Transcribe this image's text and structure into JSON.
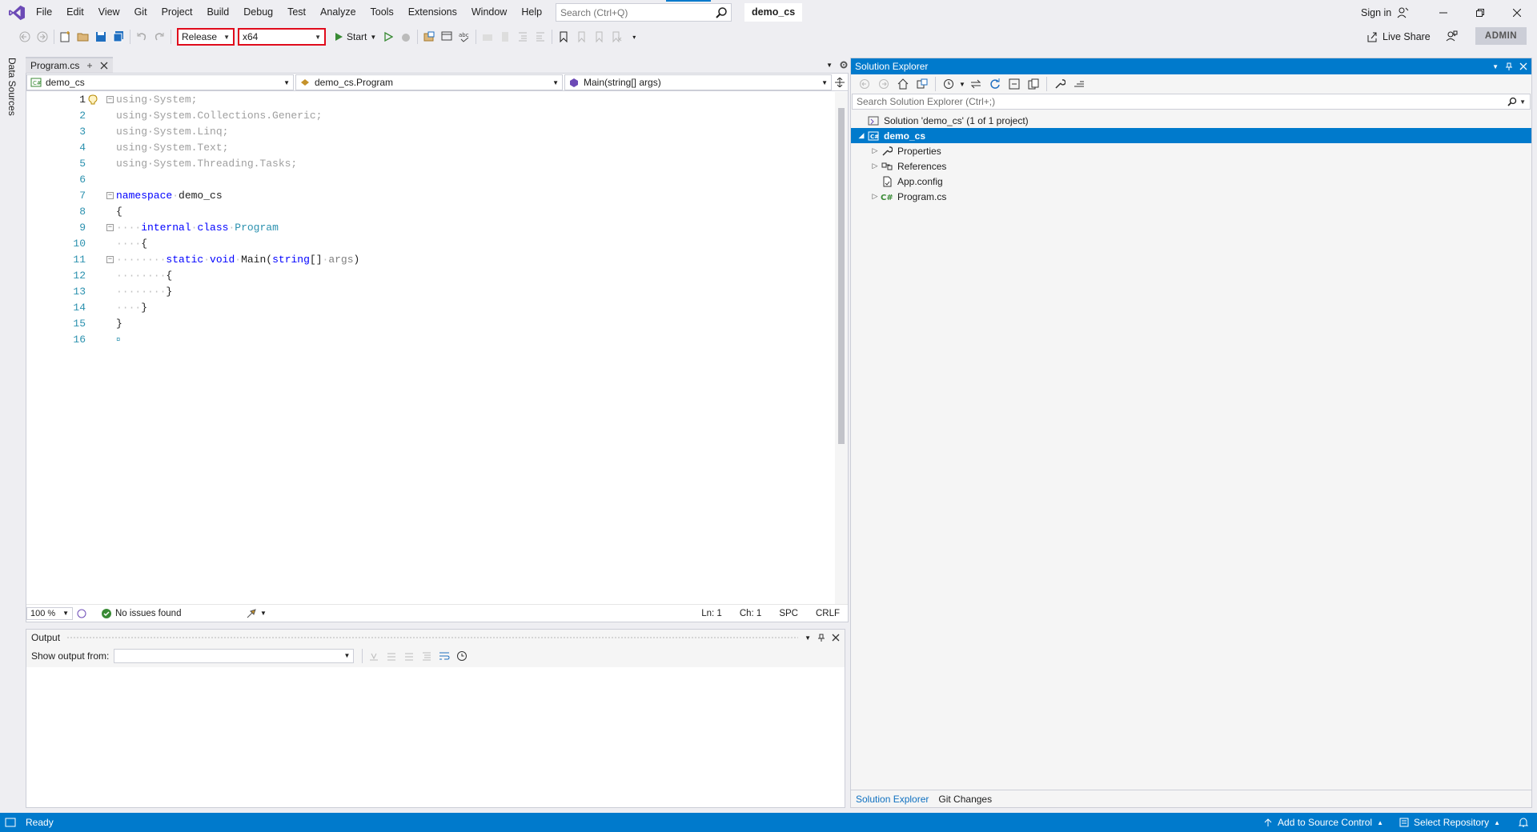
{
  "menu": [
    "File",
    "Edit",
    "View",
    "Git",
    "Project",
    "Build",
    "Debug",
    "Test",
    "Analyze",
    "Tools",
    "Extensions",
    "Window",
    "Help"
  ],
  "search": {
    "placeholder": "Search (Ctrl+Q)"
  },
  "window": {
    "solution_name": "demo_cs",
    "sign_in": "Sign in"
  },
  "toolbar": {
    "configuration": "Release",
    "platform": "x64",
    "start_label": "Start",
    "live_share": "Live Share",
    "admin": "ADMIN"
  },
  "left_strip": {
    "data_sources": "Data Sources"
  },
  "editor": {
    "tab_name": "Program.cs",
    "nav": {
      "project": "demo_cs",
      "type": "demo_cs.Program",
      "member": "Main(string[] args)"
    },
    "line_numbers": [
      "1",
      "2",
      "3",
      "4",
      "5",
      "6",
      "7",
      "8",
      "9",
      "10",
      "11",
      "12",
      "13",
      "14",
      "15",
      "16"
    ],
    "zoom": "100 %",
    "issues": "No issues found",
    "ln": "Ln: 1",
    "ch": "Ch: 1",
    "spc": "SPC",
    "crlf": "CRLF"
  },
  "output": {
    "title": "Output",
    "show_from": "Show output from:"
  },
  "solution_explorer": {
    "title": "Solution Explorer",
    "search_placeholder": "Search Solution Explorer (Ctrl+;)",
    "solution": "Solution 'demo_cs' (1 of 1 project)",
    "project": "demo_cs",
    "items": [
      "Properties",
      "References",
      "App.config",
      "Program.cs"
    ],
    "tabs": [
      "Solution Explorer",
      "Git Changes"
    ]
  },
  "statusbar": {
    "ready": "Ready",
    "add_source_control": "Add to Source Control",
    "select_repo": "Select Repository"
  },
  "colors": {
    "accent": "#007acc",
    "highlight_red": "#e00b1c",
    "keyword": "#0000ff",
    "type": "#2b91af"
  }
}
